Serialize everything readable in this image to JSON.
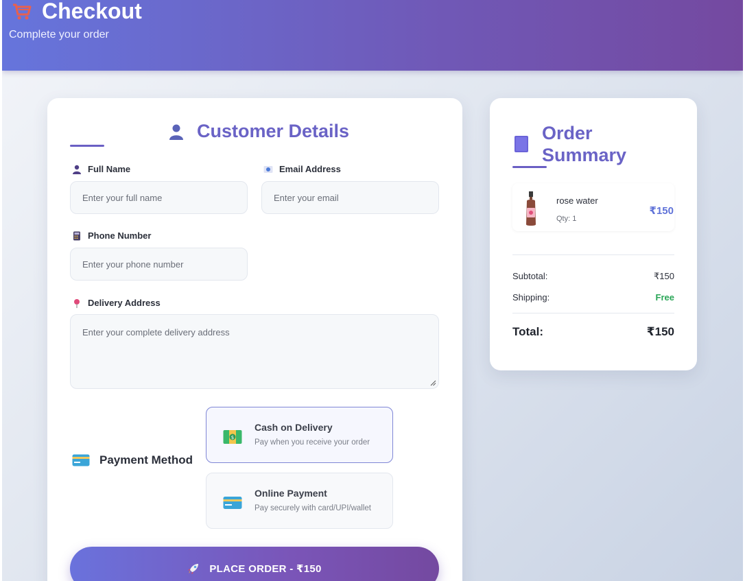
{
  "header": {
    "title": "Checkout",
    "subtitle": "Complete your order",
    "icon": "cart-icon"
  },
  "customer_details": {
    "heading": "Customer Details",
    "fields": {
      "full_name": {
        "label": "Full Name",
        "placeholder": "Enter your full name",
        "value": ""
      },
      "email": {
        "label": "Email Address",
        "placeholder": "Enter your email",
        "value": ""
      },
      "phone": {
        "label": "Phone Number",
        "placeholder": "Enter your phone number",
        "value": ""
      },
      "address": {
        "label": "Delivery Address",
        "placeholder": "Enter your complete delivery address",
        "value": ""
      }
    }
  },
  "payment": {
    "label": "Payment Method",
    "options": [
      {
        "title": "Cash on Delivery",
        "description": "Pay when you receive your order",
        "selected": true,
        "icon": "cash-icon"
      },
      {
        "title": "Online Payment",
        "description": "Pay securely with card/UPI/wallet",
        "selected": false,
        "icon": "credit-card-icon"
      }
    ]
  },
  "place_order": {
    "label": "PLACE ORDER - ₹150",
    "icon": "rocket-icon"
  },
  "order_summary": {
    "heading": "Order Summary",
    "items": [
      {
        "name": "rose water",
        "qty": "Qty: 1",
        "price": "₹150"
      }
    ],
    "subtotal": {
      "label": "Subtotal:",
      "value": "₹150"
    },
    "shipping": {
      "label": "Shipping:",
      "value": "Free"
    },
    "total": {
      "label": "Total:",
      "value": "₹150"
    }
  },
  "colors": {
    "accent": "#6a63c6",
    "header_start": "#6675dc",
    "header_end": "#7449a0",
    "free_green": "#2aa657",
    "price_blue": "#5f72d8"
  }
}
